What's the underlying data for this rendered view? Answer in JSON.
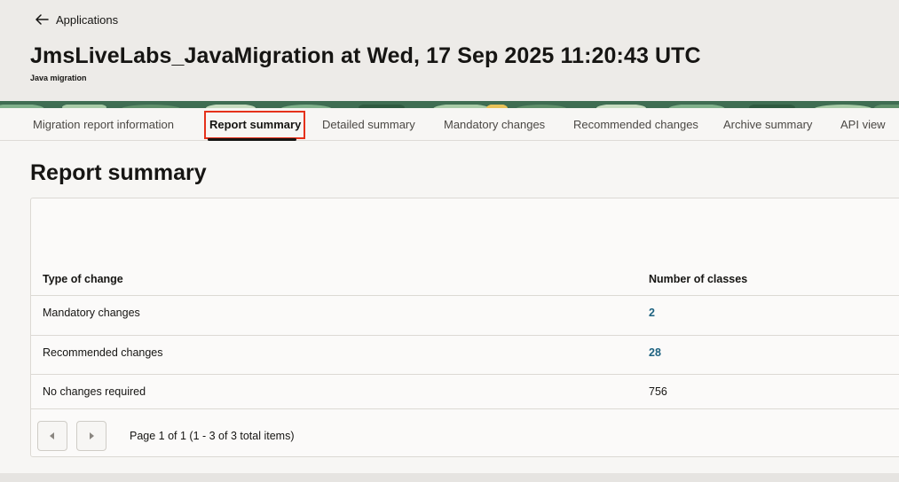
{
  "header": {
    "back_label": "Applications",
    "title": "JmsLiveLabs_JavaMigration at Wed, 17 Sep 2025 11:20:43 UTC",
    "subtitle": "Java migration"
  },
  "tabs": [
    {
      "label": "Migration report information",
      "active": false
    },
    {
      "label": "Report summary",
      "active": true
    },
    {
      "label": "Detailed summary",
      "active": false
    },
    {
      "label": "Mandatory changes",
      "active": false
    },
    {
      "label": "Recommended changes",
      "active": false
    },
    {
      "label": "Archive summary",
      "active": false
    },
    {
      "label": "API view",
      "active": false
    }
  ],
  "section": {
    "title": "Report summary"
  },
  "table": {
    "columns": [
      "Type of change",
      "Number of classes"
    ],
    "rows": [
      {
        "type": "Mandatory changes",
        "count": "2",
        "link": true
      },
      {
        "type": "Recommended changes",
        "count": "28",
        "link": true
      },
      {
        "type": "No changes required",
        "count": "756",
        "link": false
      }
    ]
  },
  "pagination": {
    "text": "Page 1 of 1 (1 - 3 of 3 total items)",
    "prev_icon": "chevron-left-icon",
    "next_icon": "chevron-right-icon"
  },
  "colors": {
    "accent_link": "#1d6280",
    "highlight_outline": "#e5311b",
    "banner": "#3f6d52"
  }
}
